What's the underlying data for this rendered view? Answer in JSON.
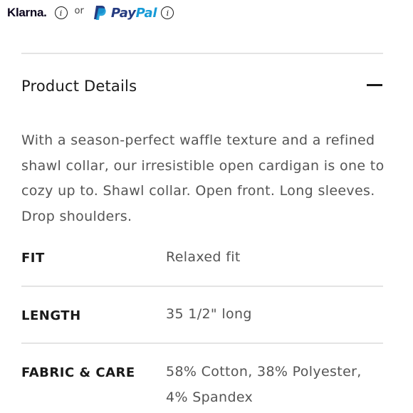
{
  "payment": {
    "klarna_label": "Klarna",
    "klarna_dot": ".",
    "info_glyph": "i",
    "or_label": "or",
    "paypal_part1": "Pay",
    "paypal_part2": "Pal"
  },
  "section": {
    "title": "Product Details",
    "state": "expanded"
  },
  "description": "With a season-perfect waffle texture and a refined shawl collar, our irresistible open cardigan is one to cozy up to. Shawl collar. Open front. Long sleeves. Drop shoulders.",
  "specs": [
    {
      "label": "FIT",
      "value": "Relaxed fit"
    },
    {
      "label": "LENGTH",
      "value": "35 1/2\" long"
    },
    {
      "label": "FABRIC & CARE",
      "value": "58% Cotton, 38% Polyester, 4% Spandex"
    }
  ],
  "colors": {
    "text_dark": "#1a1a1a",
    "text_body": "#555555",
    "divider": "#e4e4e4",
    "paypal_dark_blue": "#253b80",
    "paypal_light_blue": "#179bd7"
  }
}
